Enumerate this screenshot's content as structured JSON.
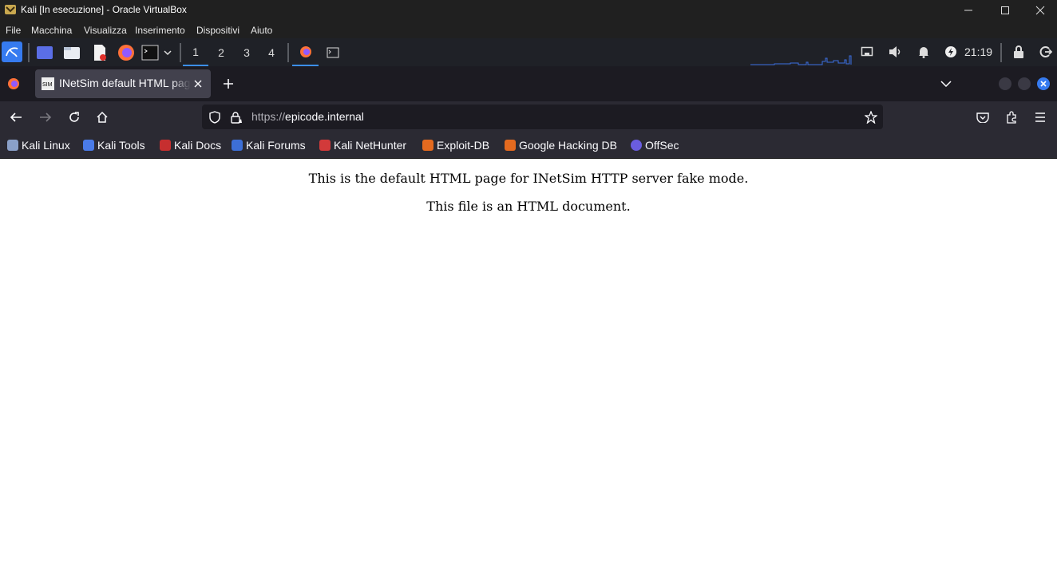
{
  "vbox": {
    "title": "Kali  [In esecuzione] - Oracle VirtualBox",
    "menu": [
      "File",
      "Macchina",
      "Visualizza",
      "Inserimento",
      "Dispositivi",
      "Aiuto"
    ]
  },
  "panel": {
    "workspaces": [
      "1",
      "2",
      "3",
      "4"
    ],
    "active_workspace": "1",
    "clock": "21:19"
  },
  "browser": {
    "tab_title": "INetSim default HTML page",
    "url_scheme": "https://",
    "url_host": "epicode.internal",
    "bookmarks": [
      "Kali Linux",
      "Kali Tools",
      "Kali Docs",
      "Kali Forums",
      "Kali NetHunter",
      "Exploit-DB",
      "Google Hacking DB",
      "OffSec"
    ]
  },
  "page": {
    "line1": "This is the default HTML page for INetSim HTTP server fake mode.",
    "line2": "This file is an HTML document."
  }
}
